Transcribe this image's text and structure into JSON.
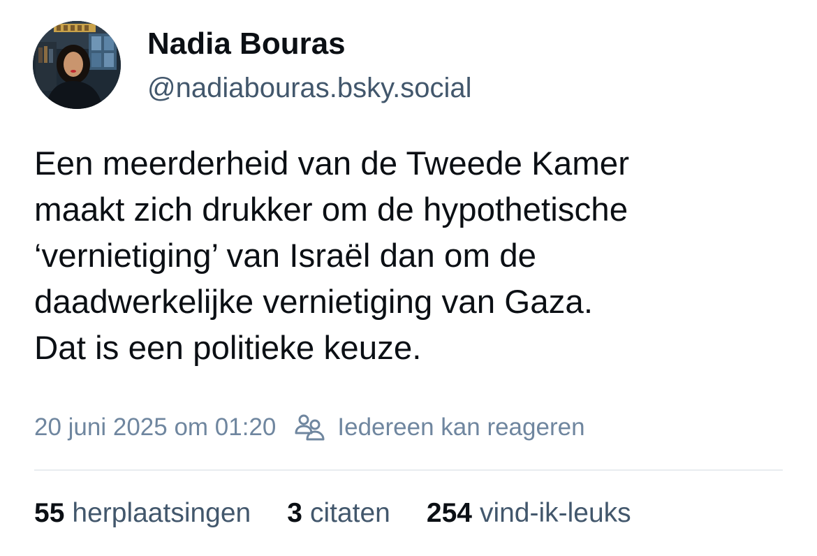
{
  "author": {
    "name": "Nadia Bouras",
    "handle": "@nadiabouras.bsky.social",
    "avatar_icon": "profile-photo"
  },
  "post": {
    "text_lines": [
      "Een meerderheid van de Tweede Kamer",
      "maakt zich drukker om de hypothetische",
      "‘vernietiging’ van Israël dan om de",
      "daadwerkelijke vernietiging van Gaza.",
      "Dat is een politieke keuze."
    ]
  },
  "meta": {
    "date": "20 juni 2025 om 01:20",
    "reply_icon": "people-icon",
    "reply_setting": "Iedereen kan reageren"
  },
  "stats": {
    "reposts": {
      "count": "55",
      "label": "herplaatsingen"
    },
    "quotes": {
      "count": "3",
      "label": "citaten"
    },
    "likes": {
      "count": "254",
      "label": "vind-ik-leuks"
    }
  },
  "colors": {
    "text_primary": "#0b0f14",
    "text_secondary": "#42576c",
    "text_meta": "#6f869f",
    "divider": "#e8ecf0"
  }
}
